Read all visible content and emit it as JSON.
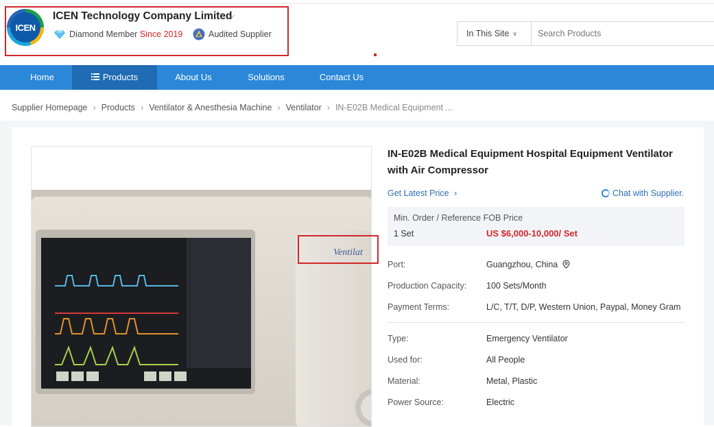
{
  "company": {
    "logo_text": "ICEN",
    "name": "ICEN Technology Company Limited",
    "member_label": "Diamond Member",
    "member_since": "Since 2019",
    "audited": "Audited Supplier"
  },
  "search": {
    "scope": "In This Site",
    "placeholder": "Search Products"
  },
  "nav": {
    "items": [
      "Home",
      "Products",
      "About Us",
      "Solutions",
      "Contact Us"
    ],
    "active": "Products"
  },
  "breadcrumb": [
    "Supplier Homepage",
    "Products",
    "Ventilator & Anesthesia Machine",
    "Ventilator",
    "IN-E02B Medical Equipment ..."
  ],
  "product": {
    "title": "IN-E02B Medical Equipment Hospital Equipment Ventilator with Air Compressor",
    "latest_price": "Get Latest Price",
    "chat": "Chat with Supplier.",
    "price_header": "Min. Order / Reference FOB Price",
    "min_order": "1 Set",
    "price": "US $6,000-10,000/ Set",
    "image_label": "Ventilat",
    "attributes_top": [
      {
        "label": "Port:",
        "value": "Guangzhou, China"
      },
      {
        "label": "Production Capacity:",
        "value": "100 Sets/Month"
      },
      {
        "label": "Payment Terms:",
        "value": "L/C, T/T, D/P, Western Union, Paypal, Money Gram"
      }
    ],
    "attributes": [
      {
        "label": "Type:",
        "value": "Emergency Ventilator"
      },
      {
        "label": "Used for:",
        "value": "All People"
      },
      {
        "label": "Material:",
        "value": "Metal, Plastic"
      },
      {
        "label": "Power Source:",
        "value": "Electric"
      }
    ]
  },
  "colors": {
    "nav": "#2b88d8",
    "nav_active": "#1f6cb4",
    "price": "#d0262c",
    "link": "#2b6fb6",
    "highlight_box": "#d0262c"
  }
}
